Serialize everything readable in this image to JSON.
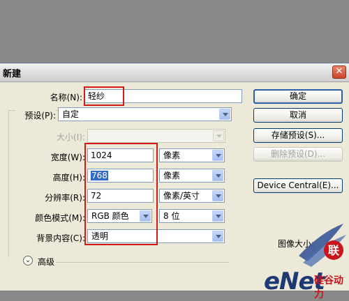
{
  "dialog": {
    "title": "新建",
    "close_glyph": "✕"
  },
  "form": {
    "name_label": "名称(N):",
    "name_value": "轻纱",
    "preset_label": "预设(P):",
    "preset_value": "自定",
    "size_label": "大小(I):",
    "size_value": "",
    "width_label": "宽度(W):",
    "width_value": "1024",
    "width_unit": "像素",
    "height_label": "高度(H):",
    "height_value": "768",
    "height_unit": "像素",
    "resolution_label": "分辨率(R):",
    "resolution_value": "72",
    "resolution_unit": "像素/英寸",
    "color_mode_label": "颜色模式(M):",
    "color_mode_value": "RGB 颜色",
    "bit_depth_value": "8 位",
    "background_label": "背景内容(C):",
    "background_value": "透明",
    "advanced_label": "高级",
    "advanced_icon": "chevron-double-down-icon",
    "image_size_label": "图像大小:"
  },
  "buttons": {
    "ok": "确定",
    "cancel": "取消",
    "save_preset": "存储预设(S)...",
    "delete_preset": "删除预设(D)...",
    "device_central": "Device Central(E)..."
  },
  "watermark": {
    "text": "eNet",
    "seal_text": "硅谷动力"
  },
  "colors": {
    "highlight_box": "#d11a1a",
    "selection": "#316ac5",
    "dialog_bg": "#ece9d8",
    "desktop_bg": "#898989"
  }
}
